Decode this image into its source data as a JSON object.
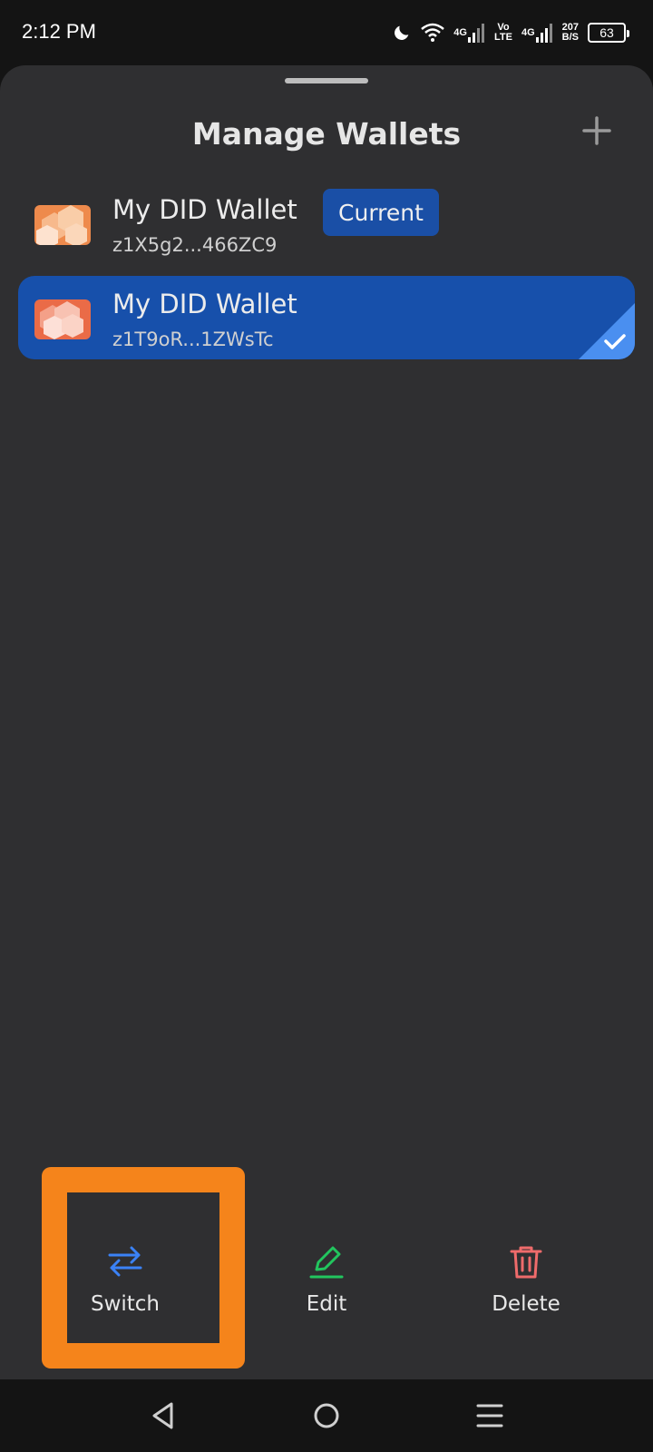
{
  "status_bar": {
    "time": "2:12 PM",
    "network_1": "4G",
    "network_2_top": "Vo",
    "network_2_bottom": "LTE",
    "network_3": "4G",
    "speed_value": "207",
    "speed_unit": "B/S",
    "battery": "63"
  },
  "sheet": {
    "title": "Manage Wallets",
    "add_icon": "plus-icon"
  },
  "wallets": [
    {
      "name": "My DID Wallet",
      "address": "z1X5g2...466ZC9",
      "badge": "Current",
      "selected": false
    },
    {
      "name": "My DID Wallet",
      "address": "z1T9oR...1ZWsTc",
      "badge": "",
      "selected": true
    }
  ],
  "actions": {
    "switch_label": "Switch",
    "edit_label": "Edit",
    "delete_label": "Delete"
  },
  "colors": {
    "selected_row": "#1750ab",
    "badge": "#1a4fa6",
    "switch_icon": "#3b82f6",
    "edit_icon": "#22c55e",
    "delete_icon": "#ef6b6b",
    "highlight": "#f5841b"
  }
}
